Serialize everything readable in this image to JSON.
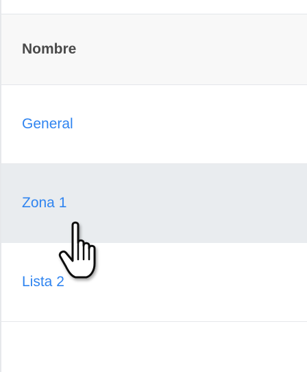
{
  "table": {
    "column_header": "Nombre",
    "rows": [
      {
        "name": "General"
      },
      {
        "name": "Zona 1"
      },
      {
        "name": "Lista 2"
      }
    ],
    "hovered_row_index": 1
  },
  "colors": {
    "link": "#2f84f0",
    "header_bg": "#f8f8f8",
    "hover_bg": "#e9ecef",
    "header_text": "#4a4a4a",
    "border": "#e3e6ea"
  },
  "cursor": {
    "icon": "hand-pointer-icon"
  }
}
